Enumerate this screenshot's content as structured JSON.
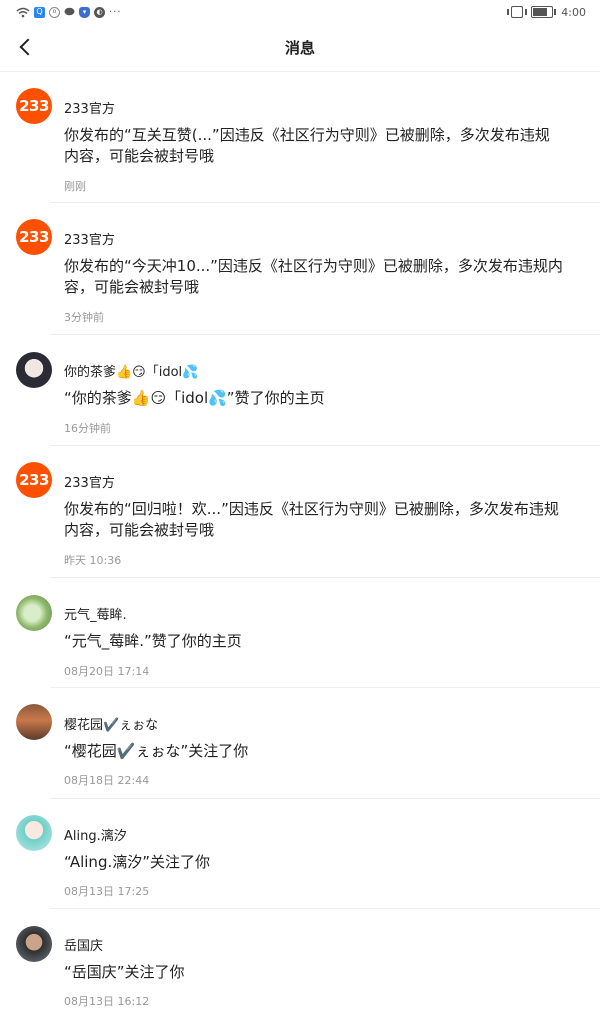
{
  "status_bar": {
    "time": "4:00",
    "battery_percent": 75,
    "extra_dots": "···"
  },
  "header": {
    "title": "消息"
  },
  "messages": [
    {
      "sender": "233官方",
      "avatar_text": "233",
      "text": "你发布的“互关互赞(...”因违反《社区行为守则》已被删除，多次发布违规内容，可能会被封号哦",
      "time": "刚刚"
    },
    {
      "sender": "233官方",
      "avatar_text": "233",
      "text": "你发布的“今天冲10...”因违反《社区行为守则》已被删除，多次发布违规内容，可能会被封号哦",
      "time": "3分钟前"
    },
    {
      "sender": "你的茶爹👍😏「idol💦",
      "text": "“你的茶爹👍😏「idol💦”赞了你的主页",
      "time": "16分钟前"
    },
    {
      "sender": "233官方",
      "avatar_text": "233",
      "text": "你发布的“回归啦！欢...”因违反《社区行为守则》已被删除，多次发布违规内容，可能会被封号哦",
      "time": "昨天 10:36"
    },
    {
      "sender": "元气_莓眸.",
      "text": "“元气_莓眸.”赞了你的主页",
      "time": "08月20日 17:14"
    },
    {
      "sender": "樱花园✔️ぇぉな",
      "text": "“樱花园✔️ぇぉな”关注了你",
      "time": "08月18日 22:44"
    },
    {
      "sender": "Aling.漓汐",
      "text": "“Aling.漓汐”关注了你",
      "time": "08月13日 17:25"
    },
    {
      "sender": "岳国庆",
      "text": "“岳国庆”关注了你",
      "time": "08月13日 16:12"
    }
  ]
}
